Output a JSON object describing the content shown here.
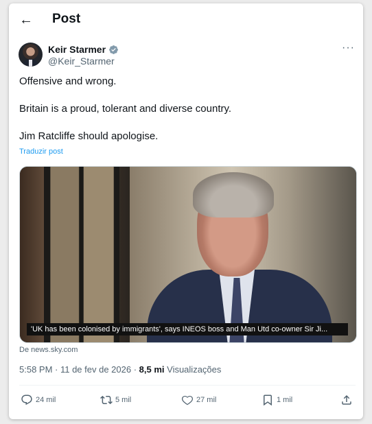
{
  "header": {
    "back_icon": "arrow-left-icon",
    "title": "Post"
  },
  "author": {
    "name": "Keir Starmer",
    "verified": true,
    "handle": "@Keir_Starmer"
  },
  "post": {
    "text": "Offensive and wrong.\n\nBritain is a proud, tolerant and diverse country.\n\nJim Ratcliffe should apologise.",
    "translate_label": "Traduzir post"
  },
  "media": {
    "caption": "'UK has been colonised by immigrants', says INEOS boss and Man Utd co-owner Sir Ji..."
  },
  "source": "De news.sky.com",
  "meta": {
    "time_date": "5:58 PM · 11 de fev de 2026 · ",
    "views_count": "8,5 mi",
    "views_label": " Visualizações"
  },
  "actions": {
    "replies": "24 mil",
    "reposts": "5 mil",
    "likes": "27 mil",
    "bookmarks": "1 mil"
  },
  "colors": {
    "link": "#1d9bf0",
    "secondary_text": "#536471",
    "verified": "#829aab"
  }
}
